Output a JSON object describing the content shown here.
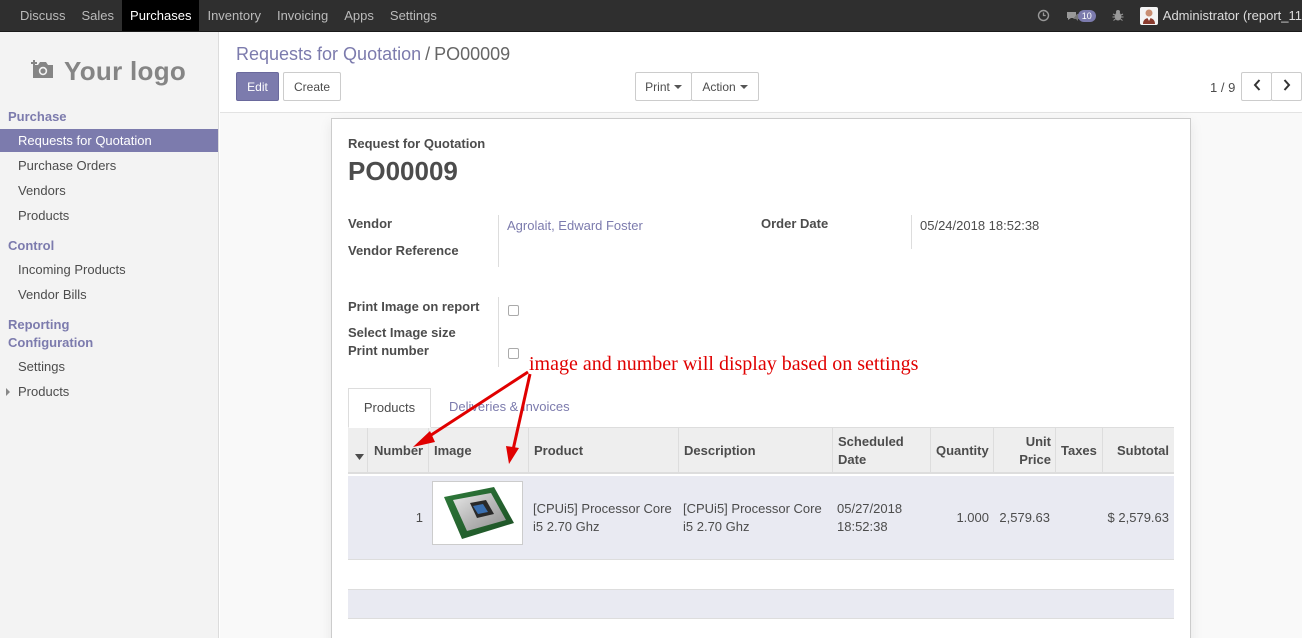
{
  "topbar": {
    "menu": [
      "Discuss",
      "Sales",
      "Purchases",
      "Inventory",
      "Invoicing",
      "Apps",
      "Settings"
    ],
    "active_menu": "Purchases",
    "messages_count": "10",
    "user": "Administrator (report_11"
  },
  "sidebar": {
    "logo": "Your logo",
    "sections": {
      "purchase": "Purchase",
      "control": "Control",
      "reporting": "Reporting",
      "configuration": "Configuration"
    },
    "items": {
      "rfq": "Requests for Quotation",
      "purchase_orders": "Purchase Orders",
      "vendors": "Vendors",
      "products": "Products",
      "incoming_products": "Incoming Products",
      "vendor_bills": "Vendor Bills",
      "settings": "Settings",
      "config_products": "Products"
    }
  },
  "breadcrumb": {
    "parent": "Requests for Quotation",
    "separator": "/",
    "current": "PO00009"
  },
  "buttons": {
    "edit": "Edit",
    "create": "Create",
    "print": "Print",
    "action": "Action"
  },
  "pager": {
    "value": "1 / 9"
  },
  "form": {
    "subtitle": "Request for Quotation",
    "title": "PO00009",
    "vendor_label": "Vendor",
    "vendor_value": "Agrolait, Edward Foster",
    "vendor_ref_label": "Vendor Reference",
    "order_date_label": "Order Date",
    "order_date_value": "05/24/2018 18:52:38",
    "print_image_label": "Print Image on report",
    "image_size_label": "Select Image size",
    "print_number_label": "Print number"
  },
  "tabs": {
    "products": "Products",
    "deliveries": "Deliveries & Invoices"
  },
  "table": {
    "headers": {
      "number": "Number",
      "image": "Image",
      "product": "Product",
      "description": "Description",
      "scheduled_1": "Scheduled",
      "scheduled_2": "Date",
      "quantity": "Quantity",
      "unit_1": "Unit",
      "unit_2": "Price",
      "taxes": "Taxes",
      "subtotal": "Subtotal"
    },
    "row": {
      "number": "1",
      "product_1": "[CPUi5] Processor Core",
      "product_2": "i5 2.70 Ghz",
      "description_1": "[CPUi5] Processor Core",
      "description_2": "i5 2.70 Ghz",
      "date_1": "05/27/2018",
      "date_2": "18:52:38",
      "quantity": "1.000",
      "unit_price": "2,579.63",
      "taxes": "",
      "subtotal": "$ 2,579.63"
    }
  },
  "annotation": "image and number will display based on settings",
  "colors": {
    "accent": "#7c7bad",
    "annotation": "#e00000",
    "topbar": "#2f2f2f"
  }
}
